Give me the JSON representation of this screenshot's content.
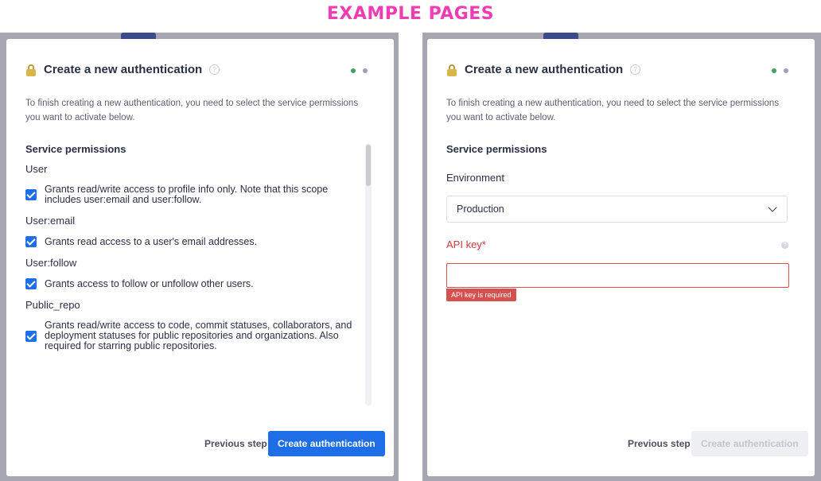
{
  "banner": "EXAMPLE PAGES",
  "colors": {
    "banner": "#f03cb4",
    "primary": "#1e6ee8",
    "error": "#d75050",
    "step_active": "#3ba55c",
    "step_inactive": "#9aa0b3"
  },
  "left": {
    "title": "Create a new authentication",
    "help_icon": "?",
    "intro": "To finish creating a new authentication, you need to select the service permissions you want to activate below.",
    "section_title": "Service permissions",
    "permissions": [
      {
        "name": "User",
        "desc": "Grants read/write access to profile info only. Note that this scope includes user:email and user:follow."
      },
      {
        "name": "User:email",
        "desc": "Grants read access to a user's email addresses."
      },
      {
        "name": "User:follow",
        "desc": "Grants access to follow or unfollow other users."
      },
      {
        "name": "Public_repo",
        "desc": "Grants read/write access to code, commit statuses, collaborators, and deployment statuses for public repositories and organizations. Also required for starring public repositories."
      }
    ],
    "prev_label": "Previous step",
    "create_label": "Create authentication"
  },
  "right": {
    "title": "Create a new authentication",
    "help_icon": "?",
    "intro": "To finish creating a new authentication, you need to select the service permissions you want to activate below.",
    "section_title": "Service permissions",
    "environment_label": "Environment",
    "environment_value": "Production",
    "api_key_label": "API key*",
    "api_key_help": "?",
    "api_key_value": "",
    "api_key_error": "API key is required",
    "prev_label": "Previous step",
    "create_label": "Create authentication"
  }
}
